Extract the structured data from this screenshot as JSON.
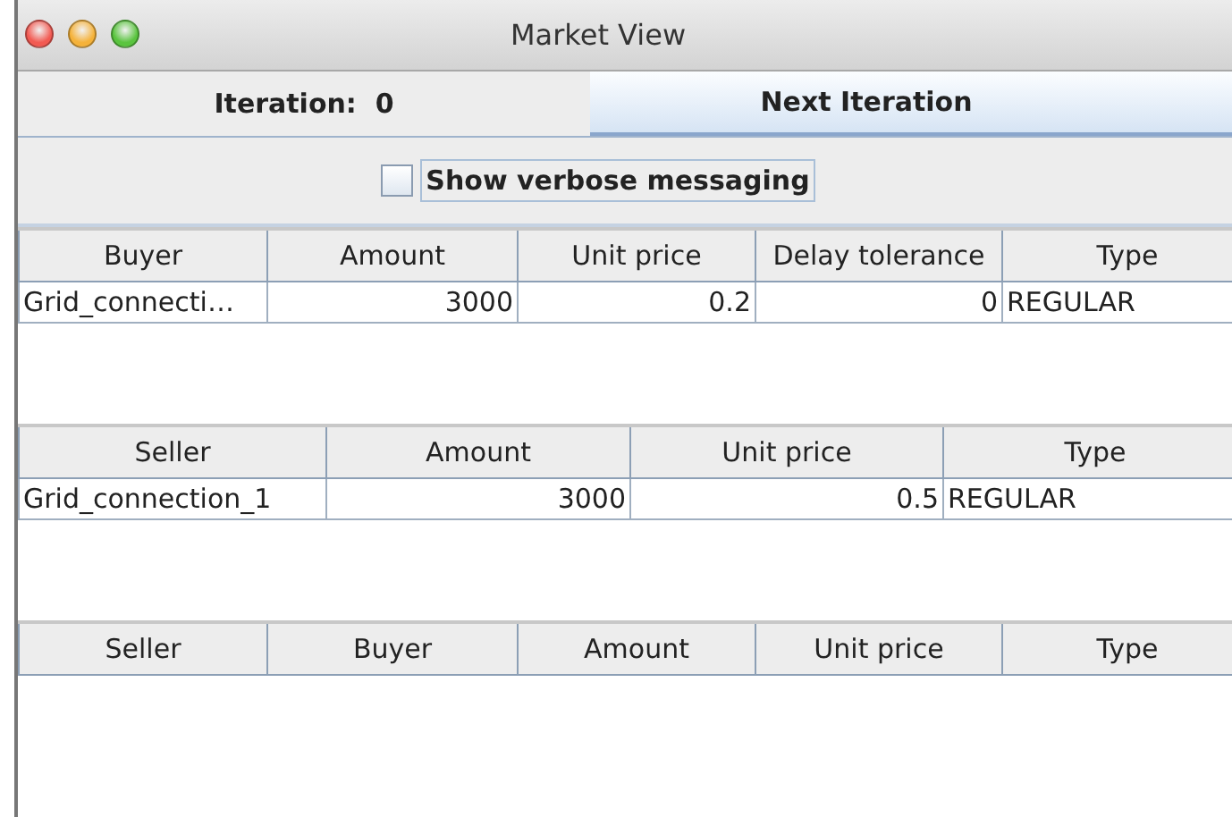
{
  "window": {
    "title": "Market View"
  },
  "iteration_label": "Iteration:  0",
  "next_button": {
    "label": "Next Iteration"
  },
  "verbose_checkbox": {
    "label": "Show verbose messaging",
    "checked": false
  },
  "tables": [
    {
      "columns": [
        {
          "label": "Buyer",
          "kind": "text"
        },
        {
          "label": "Amount",
          "kind": "number"
        },
        {
          "label": "Unit price",
          "kind": "number"
        },
        {
          "label": "Delay tolerance",
          "kind": "number"
        },
        {
          "label": "Type",
          "kind": "text"
        }
      ],
      "rows": [
        [
          "Grid_connecti…",
          "3000",
          "0.2",
          "0",
          "REGULAR"
        ]
      ]
    },
    {
      "columns": [
        {
          "label": "Seller",
          "kind": "text"
        },
        {
          "label": "Amount",
          "kind": "number"
        },
        {
          "label": "Unit price",
          "kind": "number"
        },
        {
          "label": "Type",
          "kind": "text"
        }
      ],
      "rows": [
        [
          "Grid_connection_1",
          "3000",
          "0.5",
          "REGULAR"
        ]
      ]
    },
    {
      "columns": [
        {
          "label": "Seller"
        },
        {
          "label": "Buyer"
        },
        {
          "label": "Amount"
        },
        {
          "label": "Unit price"
        },
        {
          "label": "Type"
        }
      ]
    }
  ]
}
